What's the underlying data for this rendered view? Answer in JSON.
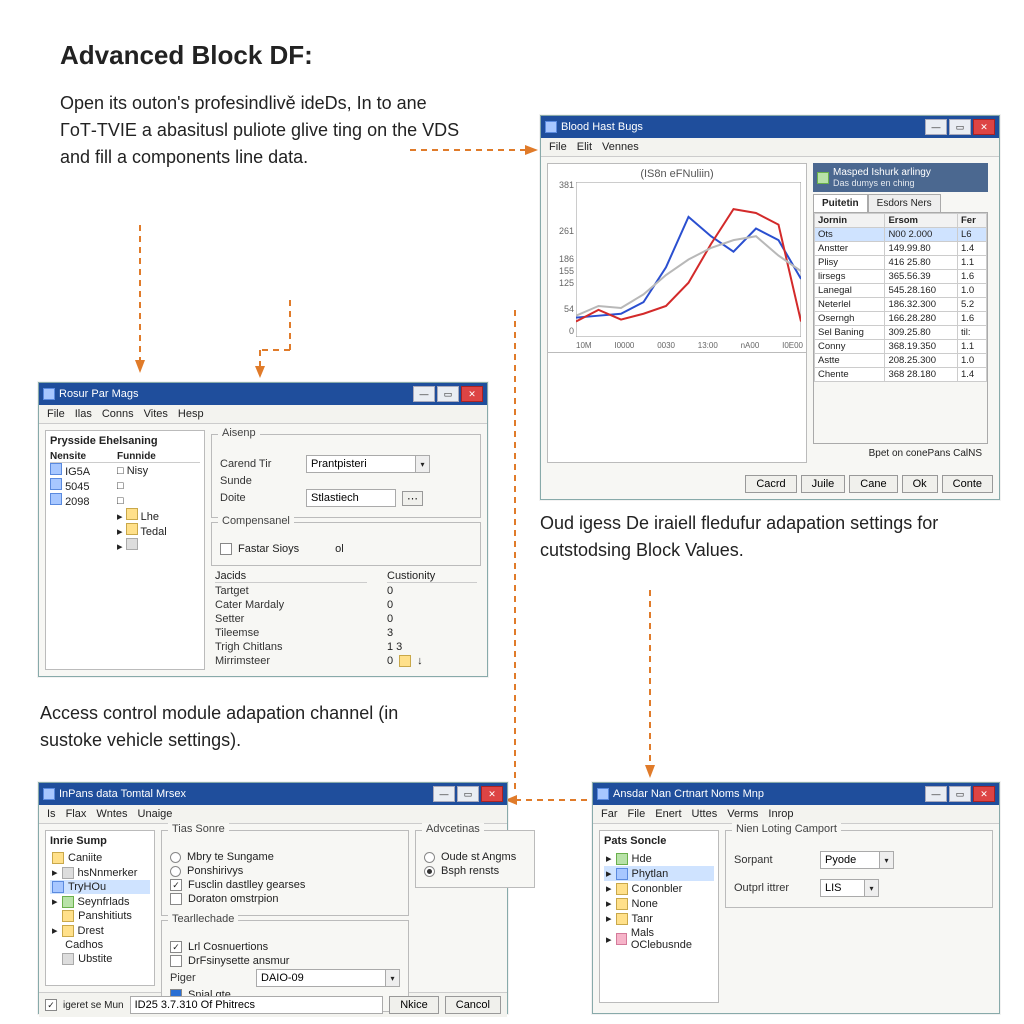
{
  "heading": "Advanced Block DF:",
  "para1": "Open its outon's profesindlivě ideDs, In to ane ΓοΤ-TVIE a abasitusl puliote glive ting on the VDS and fill a components line data.",
  "para2": "Access control module adapation channel (in sustoke vehicle settings).",
  "para3": "Oud igess De iraiell fledufur adapation settings for cutstodsing Block Values.",
  "win1": {
    "title": "Rosur Par Mags",
    "menu": [
      "File",
      "Ilas",
      "Conns",
      "Vites",
      "Hesp"
    ],
    "left_header": "Prysside Ehelsaning",
    "cols": [
      "Nensite",
      "Funnide"
    ],
    "rows": [
      {
        "a": "IG5A",
        "b": "Nisy"
      },
      {
        "a": "5045",
        "b": ""
      },
      {
        "a": "2098",
        "b": ""
      },
      {
        "a": "",
        "b": "Lhe"
      },
      {
        "a": "",
        "b": "Tedal"
      },
      {
        "a": "",
        "b": ""
      }
    ],
    "grp_assign": "Aisenp",
    "lbl_content": "Carend Tir",
    "val_content": "Prantpisteri",
    "lbl_sande": "Sunde",
    "lbl_doite": "Doite",
    "val_doite": "Stlastiech",
    "grp_comp": "Compensanel",
    "chk_fastar": "Fastar Sioys",
    "col_tactics": "Jacids",
    "col_custody": "Custionity",
    "r_target": "Tartget",
    "v_target": "0",
    "r_color": "Cater Mardaly",
    "v_color": "0",
    "r_setter": "Setter",
    "v_setter": "0",
    "r_tileeme": "Tileemse",
    "v_tileeme": "3",
    "r_trigh": "Trigh Chitlans",
    "v_trigh": "1 3",
    "r_minim": "Mirrimsteer",
    "v_minim": "0"
  },
  "win2": {
    "title": "Blood Hast Bugs",
    "menu": [
      "File",
      "Elit",
      "Vennes"
    ],
    "chart_title": "(IS8n eFNuliin)",
    "side_title": "Masped Ishurk arlingy",
    "side_sub": "Das dumys en ching",
    "tabs": [
      "Puitetin",
      "Esdors Ners"
    ],
    "cols": [
      "Jornin",
      "Ersom",
      "Fer"
    ],
    "rows": [
      {
        "a": "Ots",
        "b": "N00 2.000",
        "c": "L6"
      },
      {
        "a": "Anstter",
        "b": "149.99.80",
        "c": "1.4"
      },
      {
        "a": "Plisy",
        "b": "416 25.80",
        "c": "1.1"
      },
      {
        "a": "lirsegs",
        "b": "365.56.39",
        "c": "1.6"
      },
      {
        "a": "Lanegal",
        "b": "545.28.160",
        "c": "1.0"
      },
      {
        "a": "Neterlel",
        "b": "186.32.300",
        "c": "5.2"
      },
      {
        "a": "Oserngh",
        "b": "166.28.280",
        "c": "1.6"
      },
      {
        "a": "Sel Baning",
        "b": "309.25.80",
        "c": "til:"
      },
      {
        "a": "Conny",
        "b": "368.19.350",
        "c": "1.1"
      },
      {
        "a": "Astte",
        "b": "208.25.300",
        "c": "1.0"
      },
      {
        "a": "Chente",
        "b": "368 28.180",
        "c": "1.4"
      }
    ],
    "export": "Bpet on conePans CalNS",
    "btns": [
      "Cacrd",
      "Juile",
      "Cane",
      "Ok",
      "Conte"
    ]
  },
  "win3": {
    "title": "InPans data Tomtal Mrsex",
    "menu": [
      "Is",
      "Flax",
      "Wntes",
      "Unaige"
    ],
    "side_hdr": "Inrie Sump",
    "tree": [
      "Caniite",
      "hsNnmerker",
      "TryHOu",
      "Seynfrlads",
      "Panshitiuts",
      "Drest",
      "Cadhos",
      "Ubstite"
    ],
    "grp_tias": "Tias Sonre",
    "radios_tias": [
      "Mbry te Sungame",
      "Ponshirivys",
      "Fusclin dastlley gearses",
      "Doraton omstrpion"
    ],
    "grp_adv": "Advcetinas",
    "radios_adv": [
      "Oude st Angms",
      "Bsph rensts"
    ],
    "grp_test": "Tearllechade",
    "chks": [
      "Lrl Cosnuertions",
      "DrFsinysette ansmur"
    ],
    "lbl_payer": "Piger",
    "val_payer": "DAIO-09",
    "chk_final": "Snial gte",
    "status_chk": "igeret se Mun",
    "status_txt": "ID25 3.7.310 Of Phitrecs",
    "btn_nkice": "Nkice",
    "btn_cancel": "Cancol"
  },
  "win4": {
    "title": "Ansdar Nan Crtnart Noms Mnp",
    "menu": [
      "Far",
      "File",
      "Enert",
      "Uttes",
      "Verms",
      "Inrop"
    ],
    "side_hdr": "Pats Soncle",
    "tree": [
      "Hde",
      "Phytlan",
      "Cononbler",
      "None",
      "Tanr",
      "Mals OClebusnde"
    ],
    "grp": "Nien Loting Camport",
    "lbl_sep": "Sorpant",
    "val_sep": "Pyode",
    "lbl_out": "Outprl ittrer",
    "val_out": "LIS"
  },
  "chart_data": {
    "type": "line",
    "title": "(IS8n eFNuliin)",
    "xlabel": "",
    "ylabel": "",
    "x_ticks": [
      "10M",
      "I0000",
      "0030",
      "13:00",
      "nA00",
      "I0E00"
    ],
    "y_ticks": [
      0,
      54,
      125,
      155,
      186,
      261,
      381
    ],
    "ylim": [
      0,
      400
    ],
    "series": [
      {
        "name": "blue",
        "color": "#2a4fd0",
        "x": [
          0,
          1,
          2,
          3,
          4,
          5,
          6,
          7,
          8,
          9,
          10
        ],
        "y": [
          50,
          55,
          60,
          90,
          180,
          310,
          260,
          220,
          280,
          250,
          150
        ]
      },
      {
        "name": "red",
        "color": "#d32a2a",
        "x": [
          0,
          1,
          2,
          3,
          4,
          5,
          6,
          7,
          8,
          9,
          10
        ],
        "y": [
          40,
          70,
          45,
          60,
          80,
          140,
          240,
          330,
          320,
          290,
          40
        ]
      },
      {
        "name": "gray",
        "color": "#b8b8b8",
        "x": [
          0,
          1,
          2,
          3,
          4,
          5,
          6,
          7,
          8,
          9,
          10
        ],
        "y": [
          55,
          80,
          75,
          110,
          160,
          200,
          230,
          250,
          260,
          210,
          170
        ]
      }
    ]
  }
}
